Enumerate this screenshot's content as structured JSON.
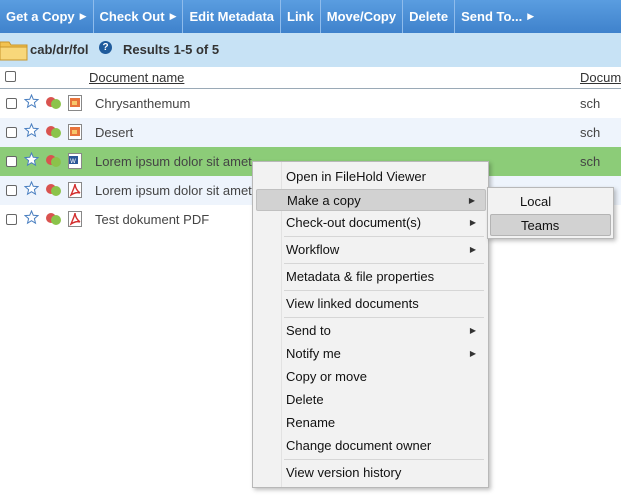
{
  "toolbar": {
    "items": [
      {
        "label": "Get a Copy",
        "has_arrow": true
      },
      {
        "label": "Check Out",
        "has_arrow": true
      },
      {
        "label": "Edit Metadata",
        "has_arrow": false
      },
      {
        "label": "Link",
        "has_arrow": false
      },
      {
        "label": "Move/Copy",
        "has_arrow": false
      },
      {
        "label": "Delete",
        "has_arrow": false
      },
      {
        "label": "Send To...",
        "has_arrow": true
      }
    ]
  },
  "breadcrumb": {
    "path": "cab/dr/fol",
    "results": "Results 1-5 of 5"
  },
  "table": {
    "columns": [
      "Document name",
      "Docum"
    ],
    "rows": [
      {
        "name": "Chrysanthemum",
        "author": "sch",
        "type": "image",
        "state": "normal"
      },
      {
        "name": "Desert",
        "author": "sch",
        "type": "image",
        "state": "alt"
      },
      {
        "name": "Lorem ipsum dolor sit amet",
        "author": "sch",
        "type": "word",
        "state": "selected"
      },
      {
        "name": "Lorem ipsum dolor sit amet",
        "author": "",
        "type": "pdf",
        "state": "alt"
      },
      {
        "name": "Test dokument PDF",
        "author": "",
        "type": "pdf",
        "state": "normal"
      }
    ]
  },
  "context_menu": {
    "items": [
      "Open in FileHold Viewer",
      "Make a copy",
      "Check-out document(s)",
      "Workflow",
      "Metadata & file properties",
      "View linked documents",
      "Send to",
      "Notify me",
      "Copy or move",
      "Delete",
      "Rename",
      "Change document owner",
      "View version history"
    ],
    "submenu": {
      "items": [
        "Local",
        "Teams"
      ]
    }
  },
  "colors": {
    "toolbar": "#3f82cc",
    "breadcrumb_bg": "#c7e2f5",
    "selected_row": "#8ccc78",
    "alt_row": "#eef4fc",
    "menu_bg": "#f2f2f2",
    "menu_highlight": "#d2d2d2"
  },
  "icons": {
    "folder": "folder-icon",
    "help": "help-icon",
    "favorite": "star-icon",
    "links": "link-icon",
    "image_file": "image-file-icon",
    "word_file": "word-file-icon",
    "pdf_file": "pdf-file-icon",
    "submenu_arrow": "submenu-arrow-icon"
  }
}
